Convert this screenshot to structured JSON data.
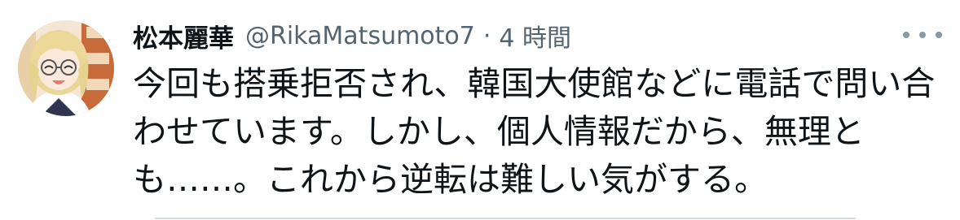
{
  "tweet": {
    "author": {
      "display_name": "松本麗華",
      "handle": "@RikaMatsumoto7"
    },
    "separator": "·",
    "timestamp": "4 時間",
    "text": "今回も搭乗拒否され、韓国大使館などに電話で問い合わせています。しかし、個人情報だから、無理とも……。これから逆転は難しい気がする。",
    "more_icon": "more-horizontal-icon"
  },
  "colors": {
    "text_primary": "#0f1419",
    "text_secondary": "#536471",
    "divider": "#cfd9de"
  }
}
